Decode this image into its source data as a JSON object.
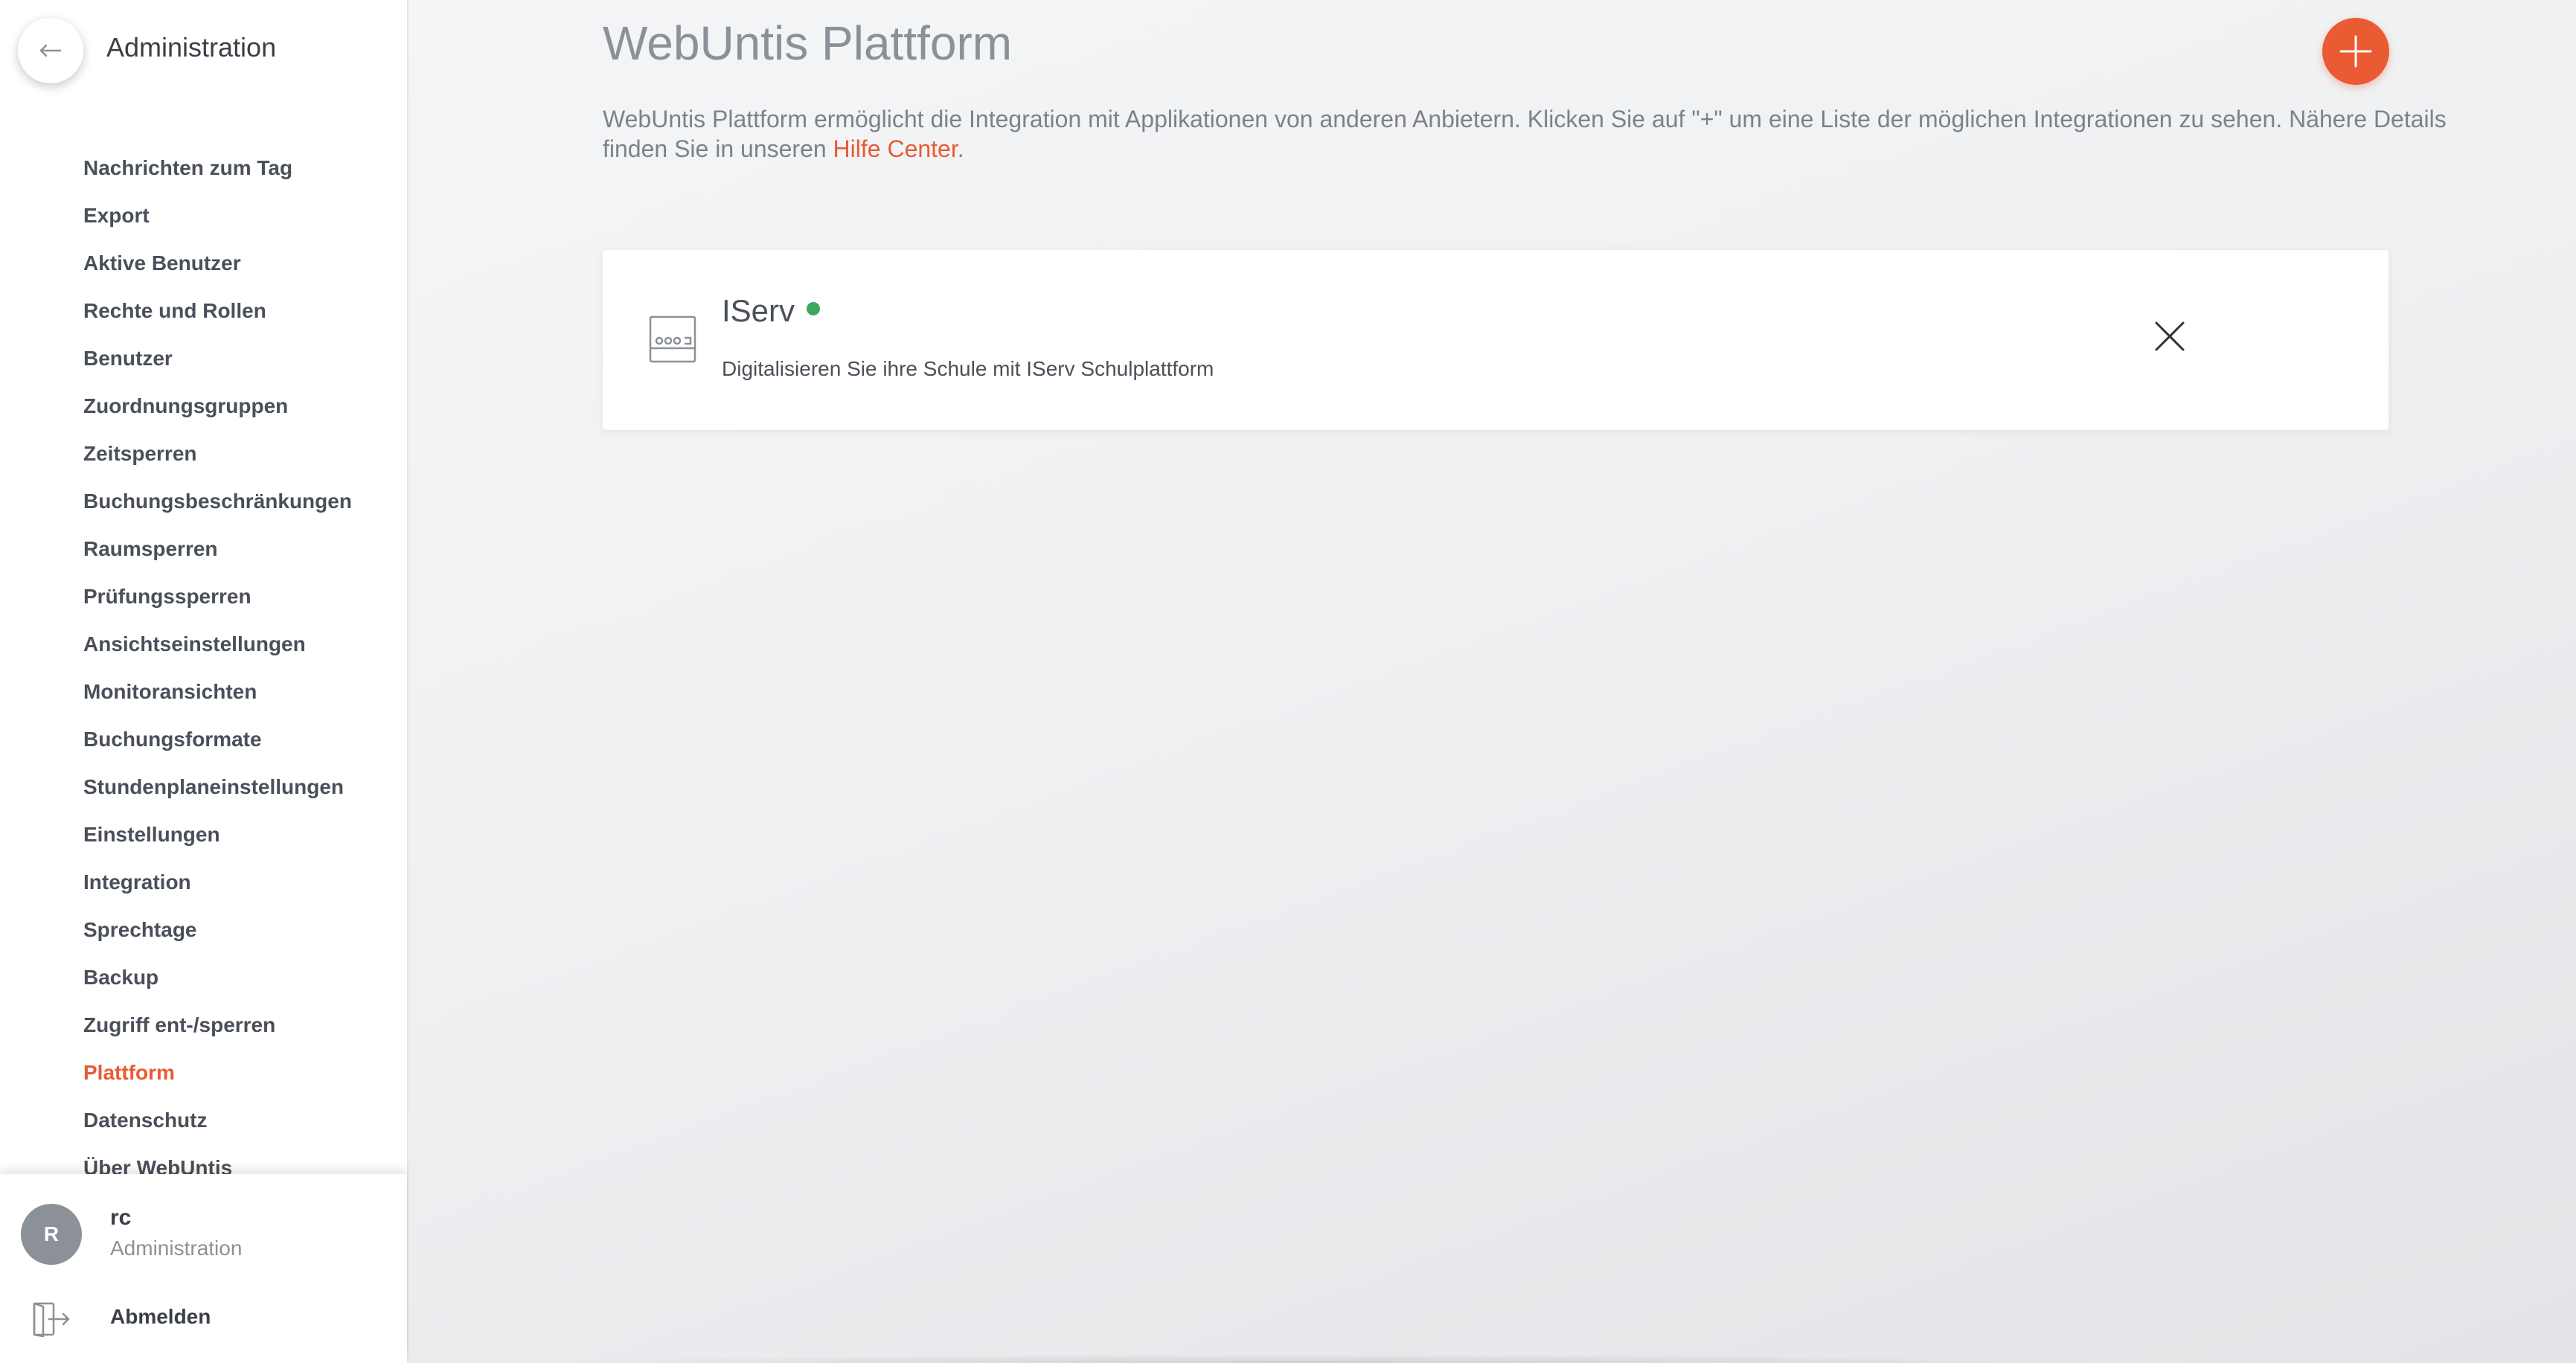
{
  "sidebar": {
    "back_icon": "arrow-left-icon",
    "title": "Administration",
    "items": [
      {
        "label": "Nachrichten zum Tag",
        "active": false
      },
      {
        "label": "Export",
        "active": false
      },
      {
        "label": "Aktive Benutzer",
        "active": false
      },
      {
        "label": "Rechte und Rollen",
        "active": false
      },
      {
        "label": "Benutzer",
        "active": false
      },
      {
        "label": "Zuordnungsgruppen",
        "active": false
      },
      {
        "label": "Zeitsperren",
        "active": false
      },
      {
        "label": "Buchungsbeschränkungen",
        "active": false
      },
      {
        "label": "Raumsperren",
        "active": false
      },
      {
        "label": "Prüfungssperren",
        "active": false
      },
      {
        "label": "Ansichtseinstellungen",
        "active": false
      },
      {
        "label": "Monitoransichten",
        "active": false
      },
      {
        "label": "Buchungsformate",
        "active": false
      },
      {
        "label": "Stundenplaneinstellungen",
        "active": false
      },
      {
        "label": "Einstellungen",
        "active": false
      },
      {
        "label": "Integration",
        "active": false
      },
      {
        "label": "Sprechtage",
        "active": false
      },
      {
        "label": "Backup",
        "active": false
      },
      {
        "label": "Zugriff ent-/sperren",
        "active": false
      },
      {
        "label": "Plattform",
        "active": true
      },
      {
        "label": "Datenschutz",
        "active": false
      },
      {
        "label": "Über WebUntis",
        "active": false
      }
    ],
    "active_color": "#e95a33"
  },
  "user": {
    "avatar_initial": "R",
    "name": "rc",
    "role": "Administration",
    "logout_label": "Abmelden",
    "logout_icon": "logout-icon"
  },
  "main": {
    "title": "WebUntis Plattform",
    "add_icon": "plus-icon",
    "description_text": "WebUntis Plattform ermöglicht die Integration mit Applikationen von anderen Anbietern. Klicken Sie auf \"+\" um eine Liste der möglichen Integrationen zu sehen. Nähere Details finden Sie in unseren ",
    "help_link": "Hilfe Center",
    "description_end": ".",
    "accent_color": "#ea5a33",
    "integrations": [
      {
        "name": "IServ",
        "status": "active",
        "status_color": "#3fa660",
        "description": "Digitalisieren Sie ihre Schule mit IServ Schulplattform",
        "icon": "integration-device-icon",
        "remove_icon": "close-icon"
      }
    ]
  }
}
